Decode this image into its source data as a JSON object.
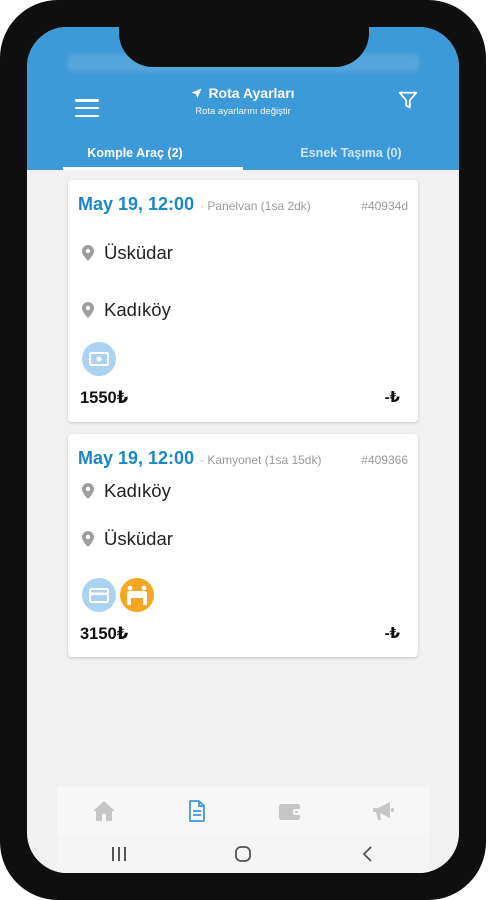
{
  "header": {
    "title": "Rota Ayarları",
    "subtitle": "Rota ayarlarını değiştir",
    "icons": {
      "menu": "hamburger-icon",
      "title": "navigation-arrow-icon",
      "filter": "filter-icon"
    }
  },
  "tabs": [
    {
      "label": "Komple Araç (2)",
      "active": true
    },
    {
      "label": "Esnek Taşıma (0)",
      "active": false
    }
  ],
  "jobs": [
    {
      "date": "May 19, 12:00",
      "vehicle": "· Panelvan (1sa 2dk)",
      "id": "#40934d",
      "from": "Üsküdar",
      "to": "Kadıköy",
      "icons": [
        "cash-icon"
      ],
      "price": "1550₺",
      "price_right": "-₺"
    },
    {
      "date": "May 19, 12:00",
      "vehicle": "· Kamyonet (1sa 15dk)",
      "id": "#409366",
      "from": "Kadıköy",
      "to": "Üsküdar",
      "icons": [
        "credit-card-icon",
        "movers-icon"
      ],
      "price": "3150₺",
      "price_right": "-₺"
    }
  ],
  "bottom_nav": [
    "home-icon",
    "document-icon",
    "wallet-icon",
    "megaphone-icon"
  ],
  "system_nav": [
    "recents-icon",
    "home-circle-icon",
    "back-icon"
  ],
  "colors": {
    "primary": "#3d9ad8",
    "date_blue": "#1a87c7",
    "cash_badge": "#a9d3f0",
    "movers_badge": "#f5a623",
    "screen_bg": "#f1f1f1"
  }
}
